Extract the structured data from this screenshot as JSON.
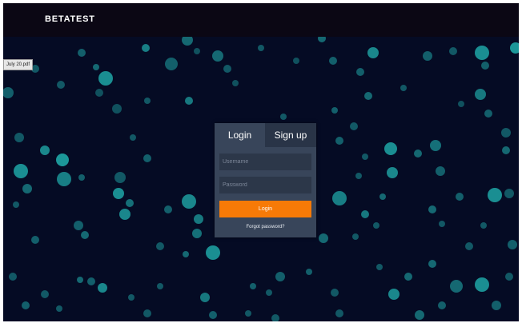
{
  "header": {
    "brand": "BETATEST"
  },
  "file_tag": {
    "label": "July 20.pdf"
  },
  "login": {
    "tabs": [
      {
        "label": "Login"
      },
      {
        "label": "Sign up"
      }
    ],
    "username_placeholder": "Username",
    "password_placeholder": "Password",
    "submit_label": "Login",
    "forgot_label": "Forgot password?"
  },
  "colors": {
    "background": "#050b24",
    "topbar": "#0b0714",
    "bubble": "#1fa6a6",
    "accent": "#f77a07",
    "panel": "#38455a"
  }
}
